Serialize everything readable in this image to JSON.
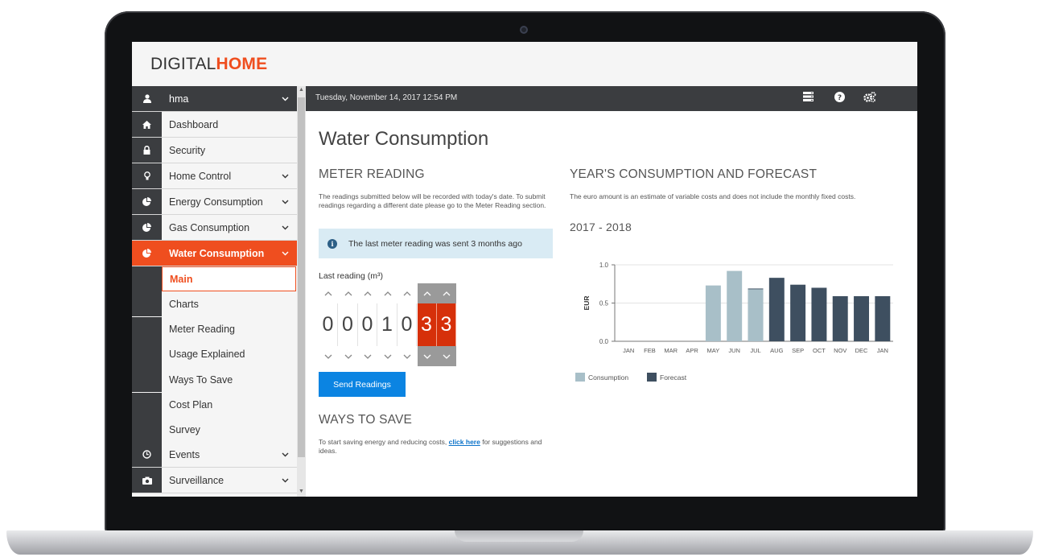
{
  "app": {
    "logo_part1": "DIGITAL",
    "logo_part2": "HOME"
  },
  "sidebar": {
    "user": {
      "label": "hma",
      "icon": "user-icon"
    },
    "items": [
      {
        "label": "Dashboard",
        "icon": "home-icon",
        "chevron": false
      },
      {
        "label": "Security",
        "icon": "lock-icon",
        "chevron": false
      },
      {
        "label": "Home Control",
        "icon": "lightbulb-icon",
        "chevron": true
      },
      {
        "label": "Energy Consumption",
        "icon": "pie-chart-icon",
        "chevron": true
      },
      {
        "label": "Gas Consumption",
        "icon": "pie-chart-icon",
        "chevron": true
      },
      {
        "label": "Water Consumption",
        "icon": "pie-chart-icon",
        "chevron": true,
        "active": true
      }
    ],
    "subitems": [
      "Main",
      "Charts",
      "Meter Reading",
      "Usage Explained",
      "Ways To Save",
      "Cost Plan",
      "Survey"
    ],
    "after_items": [
      {
        "label": "Events",
        "icon": "clock-icon",
        "chevron": true
      },
      {
        "label": "Surveillance",
        "icon": "camera-icon",
        "chevron": true
      }
    ]
  },
  "statusbar": {
    "datetime": "Tuesday, November 14, 2017 12:54 PM",
    "icons": [
      "server-icon",
      "help-icon",
      "settings-icon"
    ]
  },
  "main": {
    "title": "Water Consumption",
    "meter_heading": "METER READING",
    "meter_text": "The readings submitted below will be recorded with today's date. To submit readings regarding a different date please go to the Meter Reading section.",
    "alert_text": "The last meter reading was sent 3 months ago",
    "last_reading_label": "Last reading (m³)",
    "digits": [
      "0",
      "0",
      "0",
      "1",
      "0",
      "3",
      "3"
    ],
    "send_button": "Send Readings",
    "ways_heading": "WAYS TO SAVE",
    "ways_text_before": "To start saving energy and reducing costs,",
    "ways_link": "click here",
    "ways_text_after": "for suggestions and ideas.",
    "forecast_heading": "YEAR'S CONSUMPTION AND FORECAST",
    "forecast_text": "The euro amount is an estimate of variable costs and does not include the monthly fixed costs.",
    "year_range": "2017 - 2018"
  },
  "colors": {
    "accent": "#ef4e1f",
    "consumption": "#a8bfc8",
    "forecast": "#3e4f60",
    "button": "#0b84e2",
    "sidebar_dark": "#3b3d40"
  },
  "chart_data": {
    "type": "bar",
    "categories": [
      "JAN",
      "FEB",
      "MAR",
      "APR",
      "MAY",
      "JUN",
      "JUL",
      "AUG",
      "SEP",
      "OCT",
      "NOV",
      "DEC",
      "JAN"
    ],
    "series": [
      {
        "name": "Consumption",
        "values": [
          0,
          0,
          0,
          0,
          0.73,
          0.92,
          0.68,
          null,
          null,
          null,
          null,
          null,
          null
        ]
      },
      {
        "name": "Forecast",
        "values": [
          null,
          null,
          null,
          null,
          null,
          null,
          0.69,
          0.83,
          0.74,
          0.7,
          0.59,
          0.59,
          0.59
        ]
      }
    ],
    "ylabel": "EUR",
    "ylim": [
      0,
      1.0
    ],
    "yticks": [
      "0.0",
      "0.5",
      "1.0"
    ],
    "grid": true,
    "legend": "bottom-left"
  }
}
